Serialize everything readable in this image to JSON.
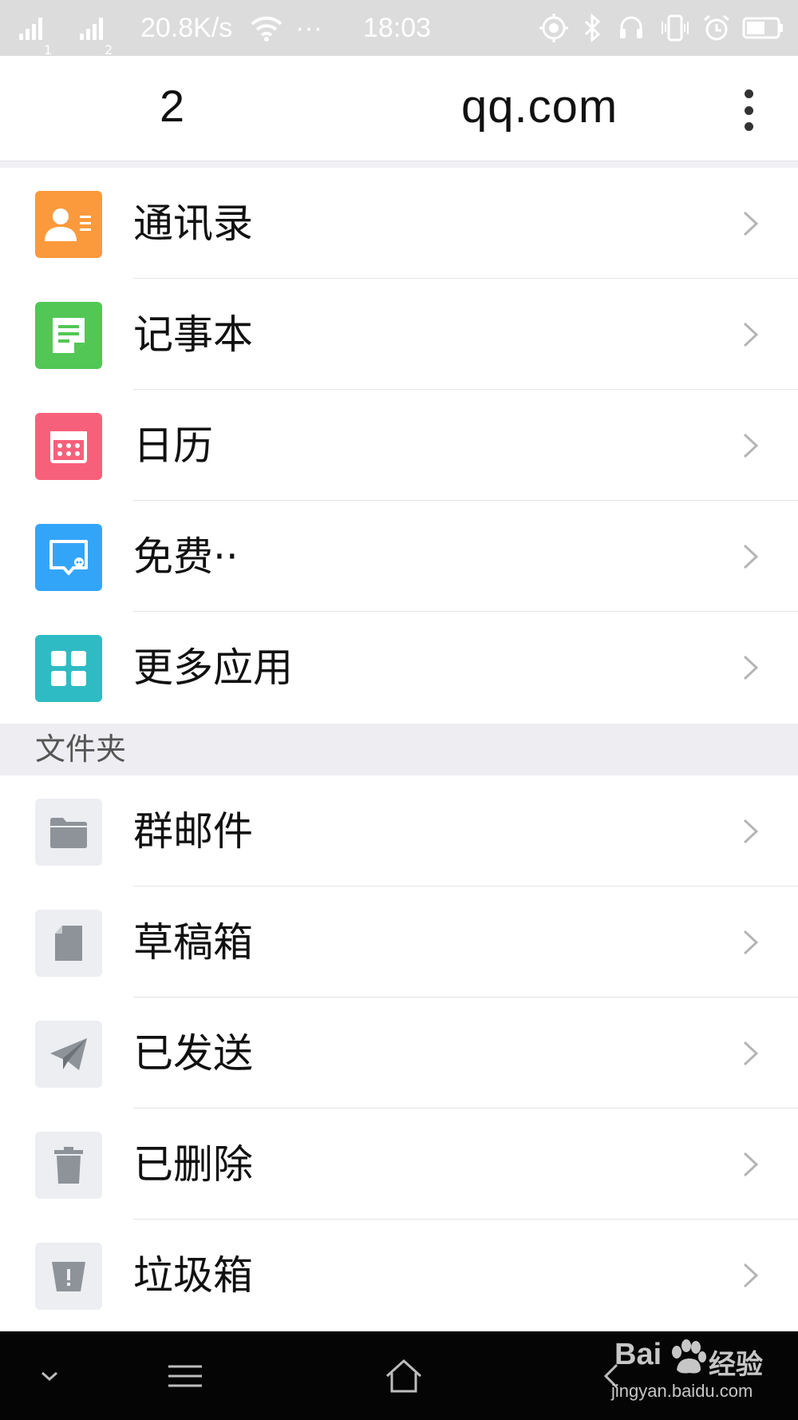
{
  "status_bar": {
    "sim1": "1",
    "sim2": "2",
    "speed": "20.8K/s",
    "dots": "···",
    "time": "18:03"
  },
  "header": {
    "account": "2",
    "domain": "qq.com"
  },
  "apps": [
    {
      "label": "通讯录",
      "icon": "contacts-icon",
      "color": "#fa9a3c"
    },
    {
      "label": "记事本",
      "icon": "notepad-icon",
      "color": "#52c755"
    },
    {
      "label": "日历",
      "icon": "calendar-icon",
      "color": "#f7607a"
    },
    {
      "label": "免费··",
      "icon": "chat-icon",
      "color": "#33a5f9"
    },
    {
      "label": "更多应用",
      "icon": "apps-grid-icon",
      "color": "#2fbbc4"
    }
  ],
  "folders_section": {
    "title": "文件夹"
  },
  "folders": [
    {
      "label": "群邮件",
      "icon": "folder-icon"
    },
    {
      "label": "草稿箱",
      "icon": "draft-icon"
    },
    {
      "label": "已发送",
      "icon": "paper-plane-icon"
    },
    {
      "label": "已删除",
      "icon": "trash-icon"
    },
    {
      "label": "垃圾箱",
      "icon": "spam-bin-icon"
    }
  ],
  "watermark": {
    "brand": "Bai",
    "brand_suffix": "经验",
    "url": "jingyan.baidu.com"
  }
}
